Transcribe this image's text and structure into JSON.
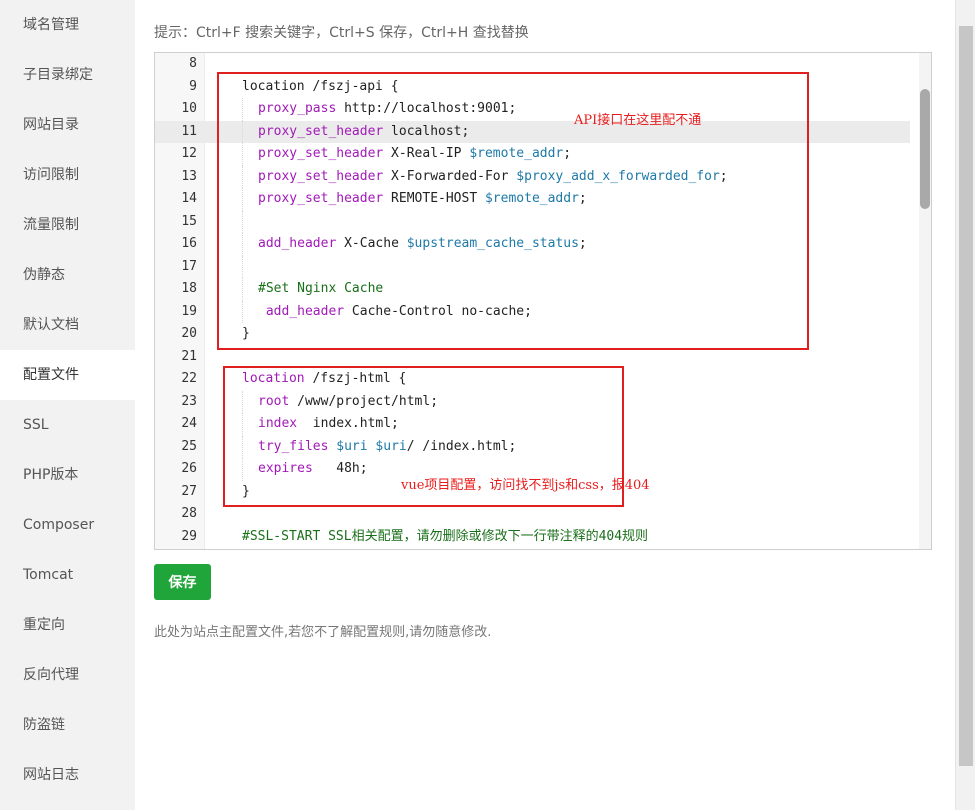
{
  "sidebar": {
    "items": [
      {
        "label": "域名管理"
      },
      {
        "label": "子目录绑定"
      },
      {
        "label": "网站目录"
      },
      {
        "label": "访问限制"
      },
      {
        "label": "流量限制"
      },
      {
        "label": "伪静态"
      },
      {
        "label": "默认文档"
      },
      {
        "label": "配置文件",
        "active": true
      },
      {
        "label": "SSL"
      },
      {
        "label": "PHP版本"
      },
      {
        "label": "Composer"
      },
      {
        "label": "Tomcat"
      },
      {
        "label": "重定向"
      },
      {
        "label": "反向代理"
      },
      {
        "label": "防盗链"
      },
      {
        "label": "网站日志"
      }
    ]
  },
  "hint": "提示：Ctrl+F 搜索关键字，Ctrl+S 保存，Ctrl+H 查找替换",
  "editor": {
    "lines": [
      {
        "n": "8",
        "parts": []
      },
      {
        "n": "9",
        "parts": [
          [
            "pl",
            "location /fszj-api {"
          ]
        ],
        "indent": 0
      },
      {
        "n": "10",
        "parts": [
          [
            "kw",
            "proxy_pass"
          ],
          [
            "pl",
            " http://localhost:9001;"
          ]
        ],
        "indent": 1
      },
      {
        "n": "11",
        "parts": [
          [
            "kw",
            "proxy_set_header"
          ],
          [
            "pl",
            " localhost;"
          ]
        ],
        "indent": 1,
        "highlight": true
      },
      {
        "n": "12",
        "parts": [
          [
            "kw",
            "proxy_set_header"
          ],
          [
            "pl",
            " X-Real-IP "
          ],
          [
            "var",
            "$remote_addr"
          ],
          [
            "pl",
            ";"
          ]
        ],
        "indent": 1
      },
      {
        "n": "13",
        "parts": [
          [
            "kw",
            "proxy_set_header"
          ],
          [
            "pl",
            " X-Forwarded-For "
          ],
          [
            "var",
            "$proxy_add_x_forwarded_for"
          ],
          [
            "pl",
            ";"
          ]
        ],
        "indent": 1
      },
      {
        "n": "14",
        "parts": [
          [
            "kw",
            "proxy_set_header"
          ],
          [
            "pl",
            " REMOTE-HOST "
          ],
          [
            "var",
            "$remote_addr"
          ],
          [
            "pl",
            ";"
          ]
        ],
        "indent": 1
      },
      {
        "n": "15",
        "parts": [],
        "indent": 1
      },
      {
        "n": "16",
        "parts": [
          [
            "kw",
            "add_header"
          ],
          [
            "pl",
            " X-Cache "
          ],
          [
            "var",
            "$upstream_cache_status"
          ],
          [
            "pl",
            ";"
          ]
        ],
        "indent": 1
      },
      {
        "n": "17",
        "parts": [],
        "indent": 1
      },
      {
        "n": "18",
        "parts": [
          [
            "cm",
            "#Set Nginx Cache"
          ]
        ],
        "indent": 1
      },
      {
        "n": "19",
        "parts": [
          [
            "pl",
            " "
          ],
          [
            "kw",
            "add_header"
          ],
          [
            "pl",
            " Cache-Control no-cache;"
          ]
        ],
        "indent": 1
      },
      {
        "n": "20",
        "parts": [
          [
            "pl",
            "}"
          ]
        ],
        "indent": 0
      },
      {
        "n": "21",
        "parts": []
      },
      {
        "n": "22",
        "parts": [
          [
            "kw",
            "location"
          ],
          [
            "pl",
            " /fszj-html {"
          ]
        ],
        "indent": 0
      },
      {
        "n": "23",
        "parts": [
          [
            "kw",
            "root"
          ],
          [
            "pl",
            " /www/project/html;"
          ]
        ],
        "indent": 1
      },
      {
        "n": "24",
        "parts": [
          [
            "kw",
            "index"
          ],
          [
            "pl",
            "  index.html;"
          ]
        ],
        "indent": 1
      },
      {
        "n": "25",
        "parts": [
          [
            "kw",
            "try_files"
          ],
          [
            "pl",
            " "
          ],
          [
            "var",
            "$uri"
          ],
          [
            "pl",
            " "
          ],
          [
            "var",
            "$uri"
          ],
          [
            "pl",
            "/ /index.html;"
          ]
        ],
        "indent": 1
      },
      {
        "n": "26",
        "parts": [
          [
            "kw",
            "expires"
          ],
          [
            "pl",
            "   48h;"
          ]
        ],
        "indent": 1
      },
      {
        "n": "27",
        "parts": [
          [
            "pl",
            "}"
          ]
        ],
        "indent": 0
      },
      {
        "n": "28",
        "parts": []
      },
      {
        "n": "29",
        "parts": [
          [
            "cm",
            "#SSL-START SSL相关配置，请勿删除或修改下一行带注释的404规则"
          ]
        ],
        "indent": 0
      }
    ]
  },
  "annotations": {
    "api": "API接口在这里配不通",
    "vue": "vue项目配置，访问找不到js和css，报404"
  },
  "save_label": "保存",
  "note": "此处为站点主配置文件,若您不了解配置规则,请勿随意修改.",
  "colors": {
    "accent": "#20a53a",
    "annotation": "#e02020"
  }
}
